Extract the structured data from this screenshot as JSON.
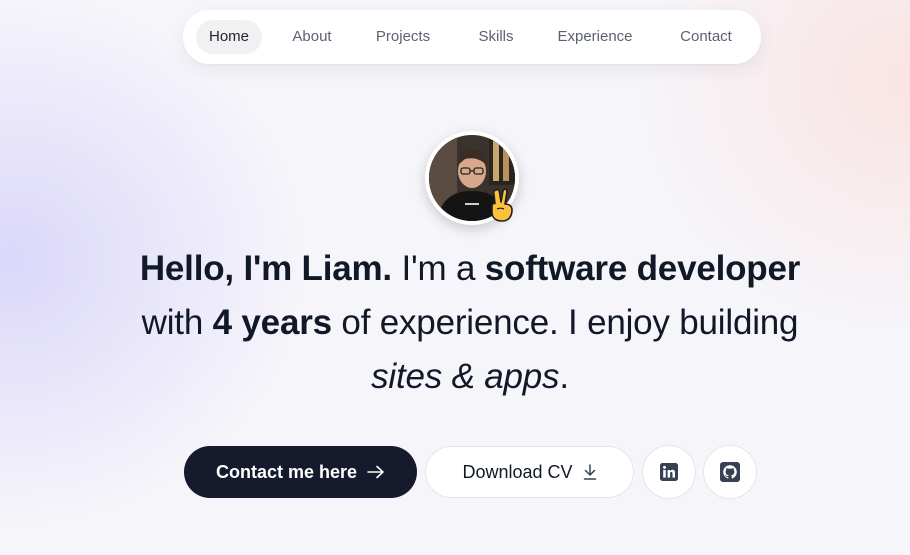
{
  "nav": {
    "items": [
      {
        "label": "Home",
        "active": true
      },
      {
        "label": "About"
      },
      {
        "label": "Projects"
      },
      {
        "label": "Skills"
      },
      {
        "label": "Experience"
      },
      {
        "label": "Contact"
      }
    ]
  },
  "hero": {
    "avatar_icon": "profile-photo",
    "badge_icon": "victory-hand-emoji",
    "headline": {
      "greeting": "Hello, I'm Liam.",
      "text1": " I'm a ",
      "role": "software developer",
      "text2": "with ",
      "years": "4 years",
      "text3": " of experience. I enjoy building",
      "focus": "sites & apps",
      "end": "."
    },
    "buttons": {
      "contact": {
        "label": "Contact me here",
        "icon": "arrow-right-icon"
      },
      "download": {
        "label": "Download CV",
        "icon": "download-icon"
      },
      "linkedin": {
        "icon": "linkedin-icon"
      },
      "github": {
        "icon": "github-icon"
      }
    }
  },
  "colors": {
    "primary_button": "#151b2c",
    "text": "#111827",
    "nav_active_bg": "#f1f1f3"
  }
}
